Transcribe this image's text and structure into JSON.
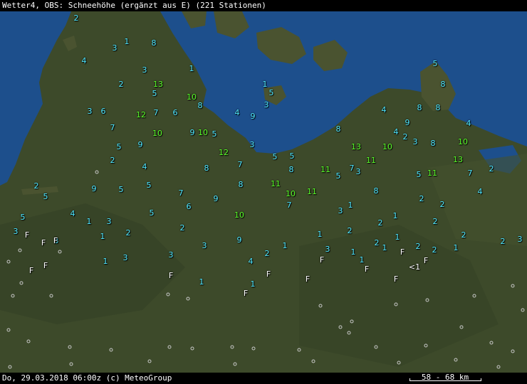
{
  "header": {
    "title": "Wetter4, OBS: Schneehöhe (ergänzt aus E) (221 Stationen)"
  },
  "footer": {
    "datetime_credit": "Do, 29.03.2018 06:00z (c) MeteoGroup",
    "scale_label": "58 - 68 km"
  },
  "colors": {
    "low": "#4fe8ff",
    "high": "#5bff2a",
    "flag": "#ffffff",
    "sea": "#1d4f8c",
    "land": "#3d4a2a"
  },
  "stations": [
    {
      "v": "2",
      "c": "low"
    },
    {
      "v": "1",
      "c": "low"
    },
    {
      "v": "8",
      "c": "low"
    },
    {
      "v": "3",
      "c": "low"
    },
    {
      "v": "4",
      "c": "low"
    },
    {
      "v": "3",
      "c": "low"
    },
    {
      "v": "1",
      "c": "low"
    },
    {
      "v": "2",
      "c": "low"
    },
    {
      "v": "13",
      "c": "high"
    },
    {
      "v": "5",
      "c": "low"
    },
    {
      "v": "10",
      "c": "high"
    },
    {
      "v": "8",
      "c": "low"
    },
    {
      "v": "1",
      "c": "low"
    },
    {
      "v": "5",
      "c": "low"
    },
    {
      "v": "3",
      "c": "low"
    },
    {
      "v": "3",
      "c": "low"
    },
    {
      "v": "6",
      "c": "low"
    },
    {
      "v": "12",
      "c": "high"
    },
    {
      "v": "7",
      "c": "low"
    },
    {
      "v": "6",
      "c": "low"
    },
    {
      "v": "4",
      "c": "low"
    },
    {
      "v": "9",
      "c": "low"
    },
    {
      "v": "7",
      "c": "low"
    },
    {
      "v": "10",
      "c": "high"
    },
    {
      "v": "9",
      "c": "low"
    },
    {
      "v": "10",
      "c": "high"
    },
    {
      "v": "5",
      "c": "low"
    },
    {
      "v": "5",
      "c": "low"
    },
    {
      "v": "9",
      "c": "low"
    },
    {
      "v": "3",
      "c": "low"
    },
    {
      "v": "12",
      "c": "high"
    },
    {
      "v": "2",
      "c": "low"
    },
    {
      "v": "4",
      "c": "low"
    },
    {
      "v": "8",
      "c": "low"
    },
    {
      "v": "7",
      "c": "low"
    },
    {
      "v": "5",
      "c": "low"
    },
    {
      "v": "5",
      "c": "low"
    },
    {
      "v": "8",
      "c": "low"
    },
    {
      "v": "2",
      "c": "low"
    },
    {
      "v": "5",
      "c": "low"
    },
    {
      "v": "9",
      "c": "low"
    },
    {
      "v": "5",
      "c": "low"
    },
    {
      "v": "5",
      "c": "low"
    },
    {
      "v": "7",
      "c": "low"
    },
    {
      "v": "8",
      "c": "low"
    },
    {
      "v": "11",
      "c": "high"
    },
    {
      "v": "10",
      "c": "high"
    },
    {
      "v": "11",
      "c": "high"
    },
    {
      "v": "9",
      "c": "low"
    },
    {
      "v": "6",
      "c": "low"
    },
    {
      "v": "7",
      "c": "low"
    },
    {
      "v": "4",
      "c": "low"
    },
    {
      "v": "5",
      "c": "low"
    },
    {
      "v": "1",
      "c": "low"
    },
    {
      "v": "3",
      "c": "low"
    },
    {
      "v": "10",
      "c": "high"
    },
    {
      "v": "1",
      "c": "low"
    },
    {
      "v": "2",
      "c": "low"
    },
    {
      "v": "2",
      "c": "low"
    },
    {
      "v": "3",
      "c": "low"
    },
    {
      "v": "9",
      "c": "low"
    },
    {
      "v": "3",
      "c": "low"
    },
    {
      "v": "3",
      "c": "low"
    },
    {
      "v": "2",
      "c": "low"
    },
    {
      "v": "1",
      "c": "low"
    },
    {
      "v": "1",
      "c": "low"
    },
    {
      "v": "3",
      "c": "low"
    },
    {
      "v": "4",
      "c": "low"
    },
    {
      "v": "1",
      "c": "low"
    },
    {
      "v": "1",
      "c": "low"
    },
    {
      "v": "5",
      "c": "low"
    },
    {
      "v": "8",
      "c": "low"
    },
    {
      "v": "4",
      "c": "low"
    },
    {
      "v": "8",
      "c": "low"
    },
    {
      "v": "8",
      "c": "low"
    },
    {
      "v": "9",
      "c": "low"
    },
    {
      "v": "4",
      "c": "low"
    },
    {
      "v": "8",
      "c": "low"
    },
    {
      "v": "4",
      "c": "low"
    },
    {
      "v": "2",
      "c": "low"
    },
    {
      "v": "3",
      "c": "low"
    },
    {
      "v": "10",
      "c": "high"
    },
    {
      "v": "11",
      "c": "high"
    },
    {
      "v": "8",
      "c": "low"
    },
    {
      "v": "10",
      "c": "high"
    },
    {
      "v": "13",
      "c": "high"
    },
    {
      "v": "13",
      "c": "high"
    },
    {
      "v": "11",
      "c": "high"
    },
    {
      "v": "7",
      "c": "low"
    },
    {
      "v": "3",
      "c": "low"
    },
    {
      "v": "5",
      "c": "low"
    },
    {
      "v": "5",
      "c": "low"
    },
    {
      "v": "11",
      "c": "high"
    },
    {
      "v": "7",
      "c": "low"
    },
    {
      "v": "2",
      "c": "low"
    },
    {
      "v": "8",
      "c": "low"
    },
    {
      "v": "4",
      "c": "low"
    },
    {
      "v": "2",
      "c": "low"
    },
    {
      "v": "2",
      "c": "low"
    },
    {
      "v": "3",
      "c": "low"
    },
    {
      "v": "1",
      "c": "low"
    },
    {
      "v": "1",
      "c": "low"
    },
    {
      "v": "2",
      "c": "low"
    },
    {
      "v": "2",
      "c": "low"
    },
    {
      "v": "1",
      "c": "low"
    },
    {
      "v": "2",
      "c": "low"
    },
    {
      "v": "1",
      "c": "low"
    },
    {
      "v": "2",
      "c": "low"
    },
    {
      "v": "3",
      "c": "low"
    },
    {
      "v": "2",
      "c": "low"
    },
    {
      "v": "1",
      "c": "low"
    },
    {
      "v": "2",
      "c": "low"
    },
    {
      "v": "2",
      "c": "low"
    },
    {
      "v": "3",
      "c": "low"
    },
    {
      "v": "1",
      "c": "low"
    },
    {
      "v": "1",
      "c": "low"
    },
    {
      "v": "2",
      "c": "low"
    },
    {
      "v": "1",
      "c": "low"
    },
    {
      "v": "5",
      "c": "low"
    },
    {
      "v": "3",
      "c": "low"
    },
    {
      "v": "F",
      "c": "flag"
    },
    {
      "v": "F",
      "c": "flag"
    },
    {
      "v": "F",
      "c": "flag"
    },
    {
      "v": "F",
      "c": "flag"
    },
    {
      "v": "F",
      "c": "flag"
    },
    {
      "v": "F",
      "c": "flag"
    },
    {
      "v": "F",
      "c": "flag"
    },
    {
      "v": "F",
      "c": "flag"
    },
    {
      "v": "F",
      "c": "flag"
    },
    {
      "v": "F",
      "c": "flag"
    },
    {
      "v": "F",
      "c": "flag"
    },
    {
      "v": "<1",
      "c": "flag"
    },
    {
      "v": "F",
      "c": "flag"
    },
    {
      "v": "F",
      "c": "flag"
    },
    {
      "v": "F",
      "c": "flag"
    }
  ]
}
